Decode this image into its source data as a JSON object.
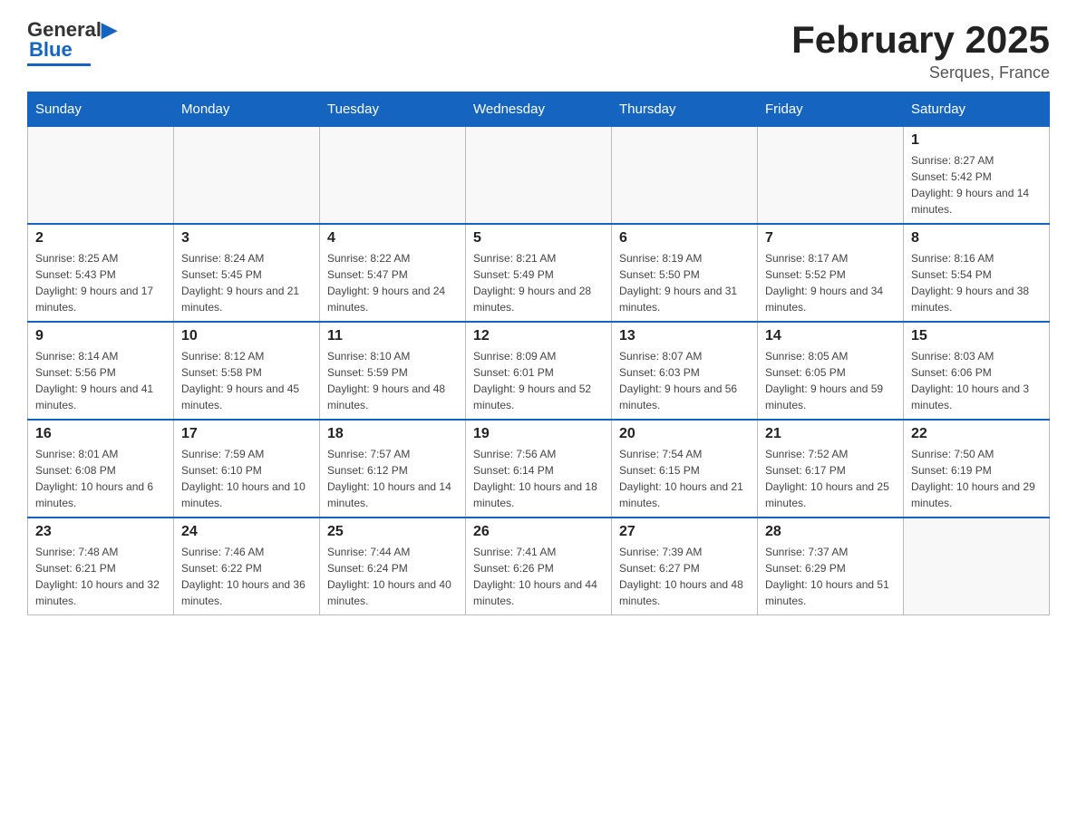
{
  "header": {
    "logo_text1": "General",
    "logo_text2": "Blue",
    "month_title": "February 2025",
    "location": "Serques, France"
  },
  "days_of_week": [
    "Sunday",
    "Monday",
    "Tuesday",
    "Wednesday",
    "Thursday",
    "Friday",
    "Saturday"
  ],
  "weeks": [
    {
      "days": [
        {
          "number": "",
          "info": ""
        },
        {
          "number": "",
          "info": ""
        },
        {
          "number": "",
          "info": ""
        },
        {
          "number": "",
          "info": ""
        },
        {
          "number": "",
          "info": ""
        },
        {
          "number": "",
          "info": ""
        },
        {
          "number": "1",
          "info": "Sunrise: 8:27 AM\nSunset: 5:42 PM\nDaylight: 9 hours and 14 minutes."
        }
      ]
    },
    {
      "days": [
        {
          "number": "2",
          "info": "Sunrise: 8:25 AM\nSunset: 5:43 PM\nDaylight: 9 hours and 17 minutes."
        },
        {
          "number": "3",
          "info": "Sunrise: 8:24 AM\nSunset: 5:45 PM\nDaylight: 9 hours and 21 minutes."
        },
        {
          "number": "4",
          "info": "Sunrise: 8:22 AM\nSunset: 5:47 PM\nDaylight: 9 hours and 24 minutes."
        },
        {
          "number": "5",
          "info": "Sunrise: 8:21 AM\nSunset: 5:49 PM\nDaylight: 9 hours and 28 minutes."
        },
        {
          "number": "6",
          "info": "Sunrise: 8:19 AM\nSunset: 5:50 PM\nDaylight: 9 hours and 31 minutes."
        },
        {
          "number": "7",
          "info": "Sunrise: 8:17 AM\nSunset: 5:52 PM\nDaylight: 9 hours and 34 minutes."
        },
        {
          "number": "8",
          "info": "Sunrise: 8:16 AM\nSunset: 5:54 PM\nDaylight: 9 hours and 38 minutes."
        }
      ]
    },
    {
      "days": [
        {
          "number": "9",
          "info": "Sunrise: 8:14 AM\nSunset: 5:56 PM\nDaylight: 9 hours and 41 minutes."
        },
        {
          "number": "10",
          "info": "Sunrise: 8:12 AM\nSunset: 5:58 PM\nDaylight: 9 hours and 45 minutes."
        },
        {
          "number": "11",
          "info": "Sunrise: 8:10 AM\nSunset: 5:59 PM\nDaylight: 9 hours and 48 minutes."
        },
        {
          "number": "12",
          "info": "Sunrise: 8:09 AM\nSunset: 6:01 PM\nDaylight: 9 hours and 52 minutes."
        },
        {
          "number": "13",
          "info": "Sunrise: 8:07 AM\nSunset: 6:03 PM\nDaylight: 9 hours and 56 minutes."
        },
        {
          "number": "14",
          "info": "Sunrise: 8:05 AM\nSunset: 6:05 PM\nDaylight: 9 hours and 59 minutes."
        },
        {
          "number": "15",
          "info": "Sunrise: 8:03 AM\nSunset: 6:06 PM\nDaylight: 10 hours and 3 minutes."
        }
      ]
    },
    {
      "days": [
        {
          "number": "16",
          "info": "Sunrise: 8:01 AM\nSunset: 6:08 PM\nDaylight: 10 hours and 6 minutes."
        },
        {
          "number": "17",
          "info": "Sunrise: 7:59 AM\nSunset: 6:10 PM\nDaylight: 10 hours and 10 minutes."
        },
        {
          "number": "18",
          "info": "Sunrise: 7:57 AM\nSunset: 6:12 PM\nDaylight: 10 hours and 14 minutes."
        },
        {
          "number": "19",
          "info": "Sunrise: 7:56 AM\nSunset: 6:14 PM\nDaylight: 10 hours and 18 minutes."
        },
        {
          "number": "20",
          "info": "Sunrise: 7:54 AM\nSunset: 6:15 PM\nDaylight: 10 hours and 21 minutes."
        },
        {
          "number": "21",
          "info": "Sunrise: 7:52 AM\nSunset: 6:17 PM\nDaylight: 10 hours and 25 minutes."
        },
        {
          "number": "22",
          "info": "Sunrise: 7:50 AM\nSunset: 6:19 PM\nDaylight: 10 hours and 29 minutes."
        }
      ]
    },
    {
      "days": [
        {
          "number": "23",
          "info": "Sunrise: 7:48 AM\nSunset: 6:21 PM\nDaylight: 10 hours and 32 minutes."
        },
        {
          "number": "24",
          "info": "Sunrise: 7:46 AM\nSunset: 6:22 PM\nDaylight: 10 hours and 36 minutes."
        },
        {
          "number": "25",
          "info": "Sunrise: 7:44 AM\nSunset: 6:24 PM\nDaylight: 10 hours and 40 minutes."
        },
        {
          "number": "26",
          "info": "Sunrise: 7:41 AM\nSunset: 6:26 PM\nDaylight: 10 hours and 44 minutes."
        },
        {
          "number": "27",
          "info": "Sunrise: 7:39 AM\nSunset: 6:27 PM\nDaylight: 10 hours and 48 minutes."
        },
        {
          "number": "28",
          "info": "Sunrise: 7:37 AM\nSunset: 6:29 PM\nDaylight: 10 hours and 51 minutes."
        },
        {
          "number": "",
          "info": ""
        }
      ]
    }
  ]
}
